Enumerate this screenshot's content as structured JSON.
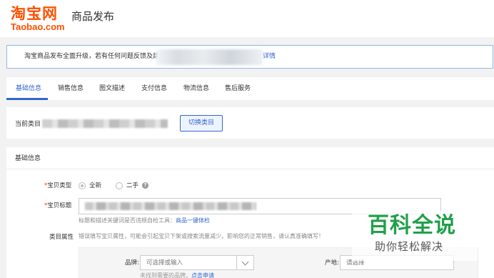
{
  "header": {
    "logo_cn": "淘宝网",
    "logo_en": "Taobao.com",
    "page_title": "商品发布",
    "brand_color": "#ff5000"
  },
  "notice": {
    "text": "淘宝商品发布全面升级，若有任何问题反馈及建议",
    "link": "详情"
  },
  "tabs": [
    {
      "label": "基础信息",
      "active": true
    },
    {
      "label": "销售信息",
      "active": false
    },
    {
      "label": "图文描述",
      "active": false
    },
    {
      "label": "支付信息",
      "active": false
    },
    {
      "label": "物流信息",
      "active": false
    },
    {
      "label": "售后服务",
      "active": false
    }
  ],
  "category": {
    "label": "当前类目",
    "switch_button": "切换类目"
  },
  "basic_info": {
    "section_title": "基础信息",
    "item_type": {
      "required_mark": "*",
      "label": "宝贝类型",
      "options": [
        "全新",
        "二手"
      ],
      "help_icon": "question-circle-icon"
    },
    "item_title": {
      "required_mark": "*",
      "label": "宝贝标题",
      "hint_prefix": "标题和描述关键词是否违规自检工具：",
      "hint_link": "商品一键体检"
    },
    "attributes": {
      "label": "类目属性",
      "hint": "错误填写宝贝属性，可能会引起宝贝下架或搜索流量减少，影响您的正常销售，请认真准确填写！",
      "brand_label": "品牌:",
      "brand_placeholder": "可选择或输入",
      "brand_hint_prefix": "未找到需要的品牌，",
      "brand_hint_link": "点击申请",
      "origin_label": "产地:",
      "origin_placeholder": "请选择"
    }
  },
  "watermark": {
    "main": "百科全说",
    "sub": "助你轻松解决",
    "color": "#21a04a"
  },
  "colors": {
    "accent": "#3366cc",
    "required": "#ff3300"
  }
}
